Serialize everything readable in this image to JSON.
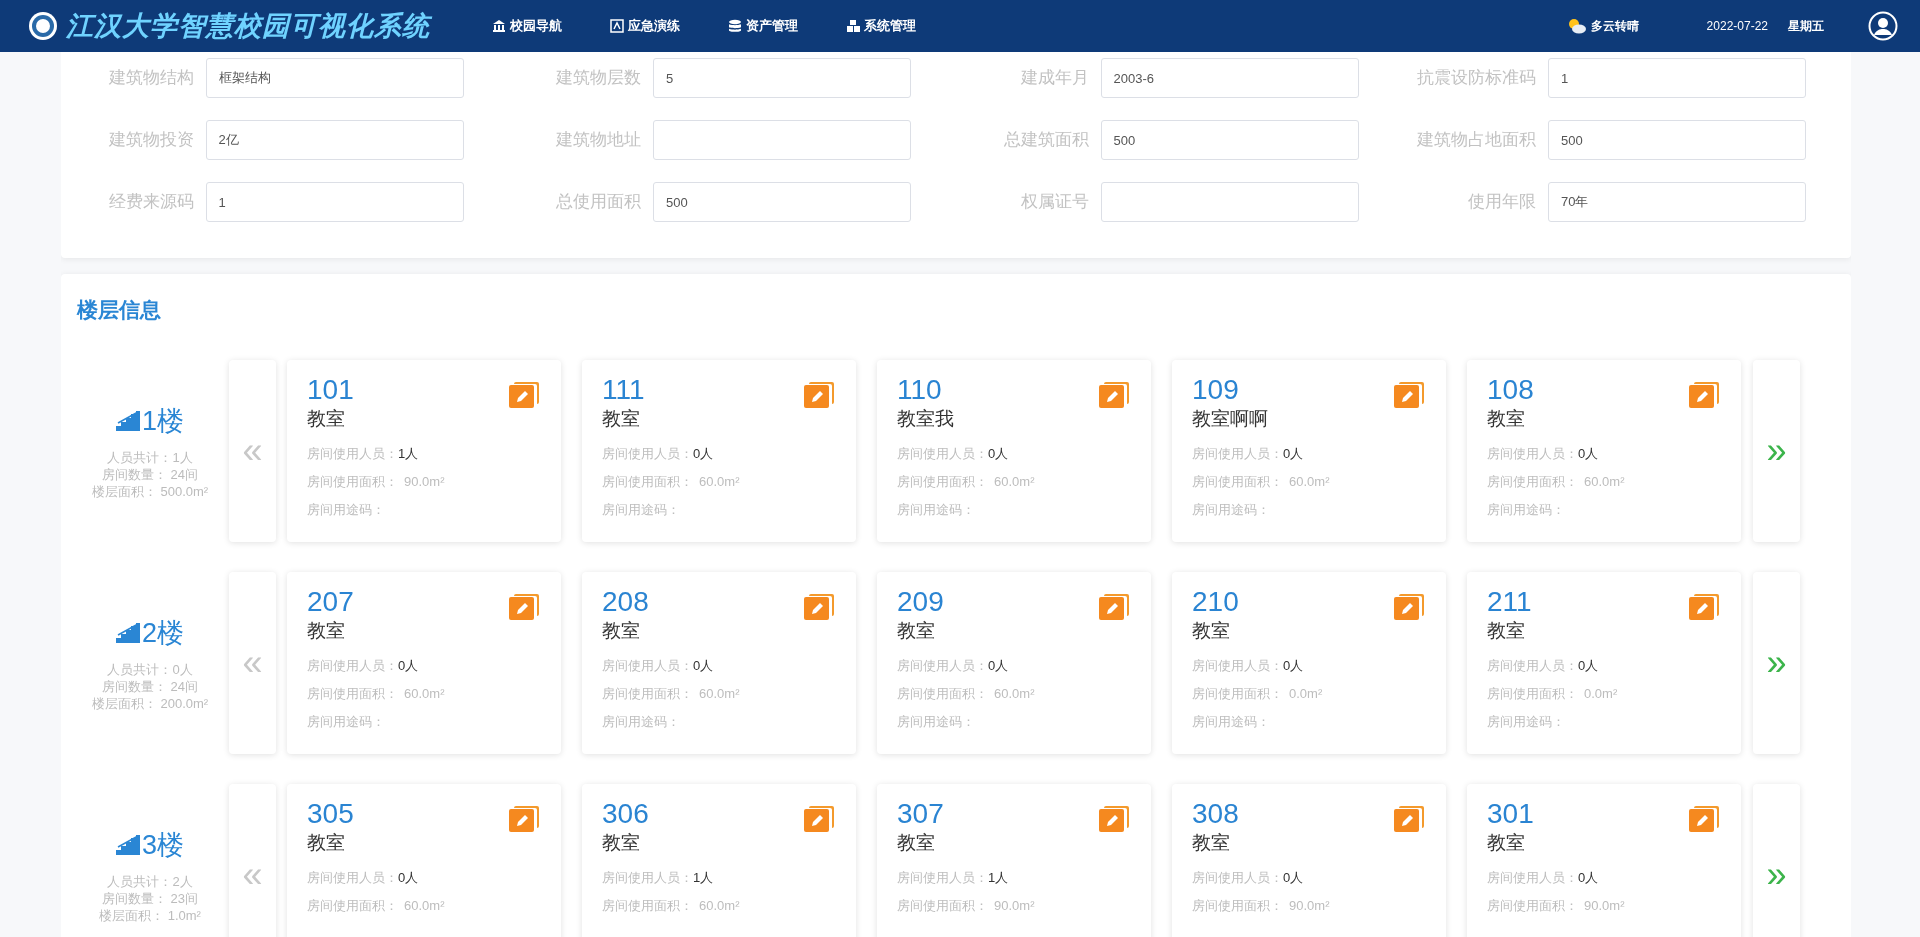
{
  "header": {
    "title": "江汉大学智慧校园可视化系统",
    "nav": [
      {
        "label": "校园导航",
        "kind": "campus"
      },
      {
        "label": "应急演练",
        "kind": "drill"
      },
      {
        "label": "资产管理",
        "kind": "assets"
      },
      {
        "label": "系统管理",
        "kind": "system"
      }
    ],
    "weather": "多云转晴",
    "date": "2022-07-22",
    "weekday": "星期五"
  },
  "building_form": {
    "fields": [
      {
        "label": "建筑物结构",
        "value": "框架结构"
      },
      {
        "label": "建筑物层数",
        "value": "5"
      },
      {
        "label": "建成年月",
        "value": "2003-6"
      },
      {
        "label": "抗震设防标准码",
        "value": "1"
      },
      {
        "label": "建筑物投资",
        "value": "2亿"
      },
      {
        "label": "建筑物地址"
      },
      {
        "label": "总建筑面积",
        "value": "500"
      },
      {
        "label": "建筑物占地面积",
        "value": "500"
      },
      {
        "label": "经费来源码",
        "value": "1"
      },
      {
        "label": "总使用面积",
        "value": "500"
      },
      {
        "label": "权属证号"
      },
      {
        "label": "使用年限",
        "value": "70年"
      }
    ]
  },
  "floor_info": {
    "title": "楼层信息",
    "prev": "«",
    "next": "»",
    "floors": [
      {
        "name": "1楼",
        "stats": [
          "人员共计：1人",
          "房间数量： 24间",
          "楼层面积： 500.0m²"
        ],
        "rooms": [
          {
            "number": "101",
            "type": "教室",
            "people_label": "房间使用人员：",
            "people": "1人",
            "area_label": "房间使用面积：",
            "area": "90.0m²",
            "use_label": "房间用途码："
          },
          {
            "number": "111",
            "type": "教室",
            "people_label": "房间使用人员：",
            "people": "0人",
            "area_label": "房间使用面积：",
            "area": "60.0m²",
            "use_label": "房间用途码："
          },
          {
            "number": "110",
            "type": "教室我",
            "people_label": "房间使用人员：",
            "people": "0人",
            "area_label": "房间使用面积：",
            "area": "60.0m²",
            "use_label": "房间用途码："
          },
          {
            "number": "109",
            "type": "教室啊啊",
            "people_label": "房间使用人员：",
            "people": "0人",
            "area_label": "房间使用面积：",
            "area": "60.0m²",
            "use_label": "房间用途码："
          },
          {
            "number": "108",
            "type": "教室",
            "people_label": "房间使用人员：",
            "people": "0人",
            "area_label": "房间使用面积：",
            "area": "60.0m²",
            "use_label": "房间用途码："
          }
        ]
      },
      {
        "name": "2楼",
        "stats": [
          "人员共计：0人",
          "房间数量： 24间",
          "楼层面积： 200.0m²"
        ],
        "rooms": [
          {
            "number": "207",
            "type": "教室",
            "people_label": "房间使用人员：",
            "people": "0人",
            "area_label": "房间使用面积：",
            "area": "60.0m²",
            "use_label": "房间用途码："
          },
          {
            "number": "208",
            "type": "教室",
            "people_label": "房间使用人员：",
            "people": "0人",
            "area_label": "房间使用面积：",
            "area": "60.0m²",
            "use_label": "房间用途码："
          },
          {
            "number": "209",
            "type": "教室",
            "people_label": "房间使用人员：",
            "people": "0人",
            "area_label": "房间使用面积：",
            "area": "60.0m²",
            "use_label": "房间用途码："
          },
          {
            "number": "210",
            "type": "教室",
            "people_label": "房间使用人员：",
            "people": "0人",
            "area_label": "房间使用面积：",
            "area": "0.0m²",
            "use_label": "房间用途码："
          },
          {
            "number": "211",
            "type": "教室",
            "people_label": "房间使用人员：",
            "people": "0人",
            "area_label": "房间使用面积：",
            "area": "0.0m²",
            "use_label": "房间用途码："
          }
        ]
      },
      {
        "name": "3楼",
        "stats": [
          "人员共计：2人",
          "房间数量： 23间",
          "楼层面积： 1.0m²"
        ],
        "rooms": [
          {
            "number": "305",
            "type": "教室",
            "people_label": "房间使用人员：",
            "people": "0人",
            "area_label": "房间使用面积：",
            "area": "60.0m²"
          },
          {
            "number": "306",
            "type": "教室",
            "people_label": "房间使用人员：",
            "people": "1人",
            "area_label": "房间使用面积：",
            "area": "60.0m²"
          },
          {
            "number": "307",
            "type": "教室",
            "people_label": "房间使用人员：",
            "people": "1人",
            "area_label": "房间使用面积：",
            "area": "90.0m²"
          },
          {
            "number": "308",
            "type": "教室",
            "people_label": "房间使用人员：",
            "people": "0人",
            "area_label": "房间使用面积：",
            "area": "90.0m²"
          },
          {
            "number": "301",
            "type": "教室",
            "people_label": "房间使用人员：",
            "people": "0人",
            "area_label": "房间使用面积：",
            "area": "90.0m²"
          }
        ]
      }
    ]
  }
}
